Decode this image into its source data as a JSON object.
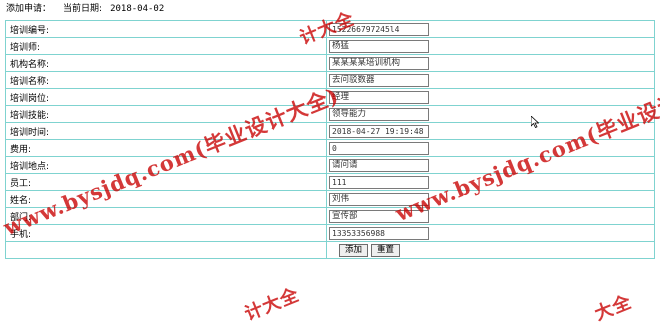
{
  "header": {
    "title": "添加申请：",
    "date_label": "当前日期:",
    "date_value": "2018-04-02"
  },
  "form": {
    "rows": [
      {
        "label": "培训编号:",
        "value": "152266797245l4"
      },
      {
        "label": "培训师:",
        "value": "杨猛"
      },
      {
        "label": "机构名称:",
        "value": "某某某某培训机构"
      },
      {
        "label": "培训名称:",
        "value": "去问驳数器"
      },
      {
        "label": "培训岗位:",
        "value": "经理"
      },
      {
        "label": "培训技能:",
        "value": "领导能力"
      },
      {
        "label": "培训时间:",
        "value": "2018-04-27 19:19:48"
      },
      {
        "label": "费用:",
        "value": "0"
      },
      {
        "label": "培训地点:",
        "value": "请问请"
      },
      {
        "label": "员工:",
        "value": "111"
      },
      {
        "label": "姓名:",
        "value": "刘伟"
      },
      {
        "label": "部门:",
        "value": "宣传部"
      },
      {
        "label": "手机:",
        "value": "13353356988"
      }
    ],
    "submit_label": "添加",
    "reset_label": "重置"
  },
  "watermark": {
    "text": "www.bysjdq.com(毕业设计大全)",
    "fragment_a": "计大全",
    "fragment_b": "计大全",
    "fragment_c": "大全"
  },
  "colors": {
    "table_border": "#7fd3d0",
    "watermark": "#c80000"
  }
}
